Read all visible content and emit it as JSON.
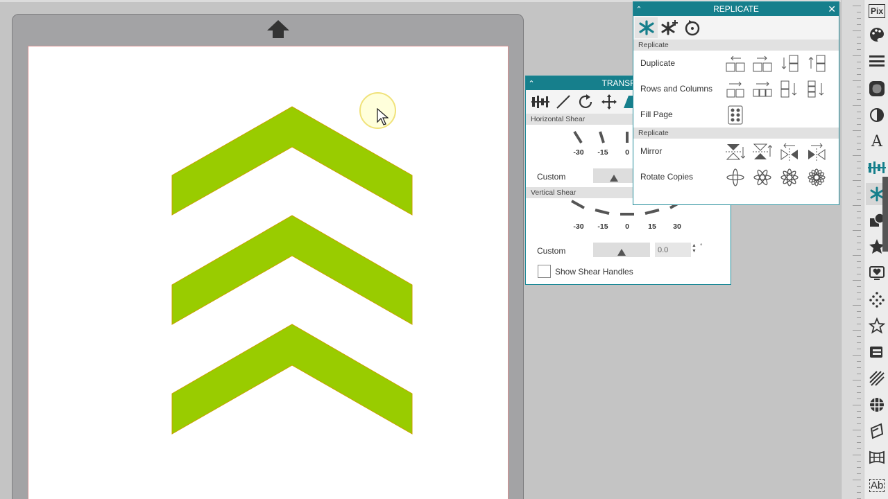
{
  "transform_panel": {
    "title": "TRANSFORM",
    "horizontal_shear": {
      "section_label": "Horizontal Shear",
      "presets": [
        "-30",
        "-15",
        "0"
      ],
      "custom_label": "Custom"
    },
    "vertical_shear": {
      "section_label": "Vertical Shear",
      "presets": [
        "-30",
        "-15",
        "0",
        "15",
        "30"
      ],
      "custom_label": "Custom",
      "value": "0.0",
      "unit": "°"
    },
    "show_shear_handles_label": "Show Shear Handles",
    "show_shear_handles_checked": false
  },
  "replicate_panel": {
    "title": "REPLICATE",
    "close_label": "✕",
    "section1_label": "Replicate",
    "section2_label": "Replicate",
    "rows": {
      "duplicate": "Duplicate",
      "rows_and_columns": "Rows and Columns",
      "fill_page": "Fill Page",
      "mirror": "Mirror",
      "rotate_copies": "Rotate Copies"
    }
  },
  "sidebar": {
    "pixscan_label": "Pix",
    "text_label": "A",
    "text_style_label": "Ab"
  },
  "colors": {
    "accent": "#167f8c",
    "chevron_fill": "#99cc00",
    "chevron_stroke": "#c8a000",
    "mat": "#a3a3a5"
  },
  "canvas": {
    "shape_count_label": ""
  }
}
